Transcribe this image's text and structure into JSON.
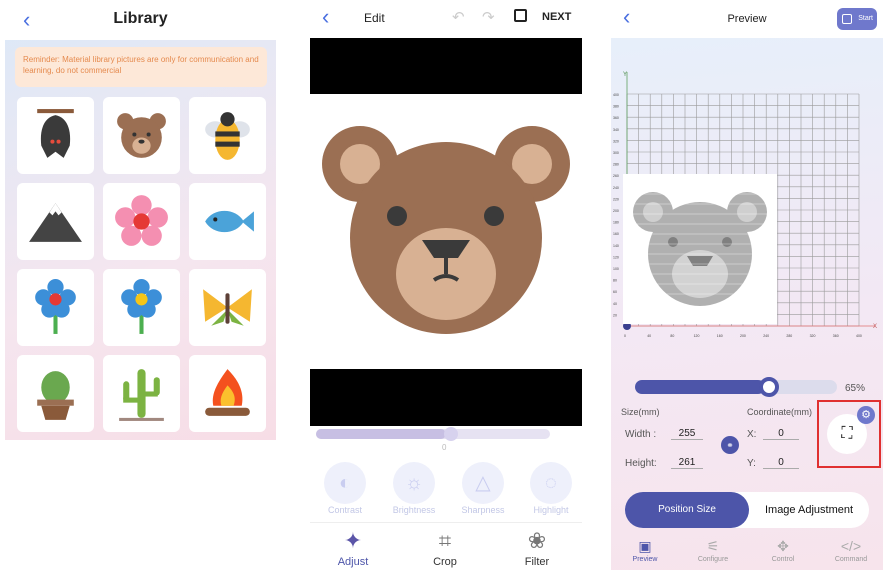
{
  "library": {
    "title": "Library",
    "reminder": "Reminder: Material library pictures are only for communication and learning, do not commercial",
    "items": [
      "bat-icon",
      "bear-icon",
      "bee-icon",
      "mountain-icon",
      "flower-pink-icon",
      "fish-icon",
      "flower-blue-red-icon",
      "flower-blue-yellow-icon",
      "butterfly-icon",
      "cactus-pot-icon",
      "cactus-icon",
      "campfire-icon"
    ]
  },
  "edit": {
    "title": "Edit",
    "next": "NEXT",
    "slider_value": "0",
    "tools": [
      "Contrast",
      "Brightness",
      "Sharpness",
      "Highlight"
    ],
    "tabs": [
      "Adjust",
      "Crop",
      "Filter"
    ]
  },
  "preview": {
    "title": "Preview",
    "start_label": "Start",
    "scale_percent": "65%",
    "size_label": "Size(mm)",
    "coord_label": "Coordinate(mm)",
    "width_label": "Width :",
    "width_value": "255",
    "height_label": "Height:",
    "height_value": "261",
    "x_label": "X:",
    "x_value": "0",
    "y_label": "Y:",
    "y_value": "0",
    "y_axis": "Y",
    "x_axis": "X",
    "y_ticks": [
      "400",
      "380",
      "360",
      "340",
      "320",
      "300",
      "280",
      "260",
      "240",
      "220",
      "200",
      "180",
      "160",
      "140",
      "120",
      "100",
      "80",
      "60",
      "40",
      "20"
    ],
    "x_ticks": [
      "0",
      "40",
      "80",
      "120",
      "160",
      "200",
      "240",
      "280",
      "320",
      "360",
      "400"
    ],
    "segment_position": "Position Size",
    "segment_image": "Image Adjustment",
    "tabs": [
      "Preview",
      "Configure",
      "Control",
      "Command"
    ]
  },
  "colors": {
    "accent": "#4d55a9",
    "warn": "#e58a4e",
    "highlight": "#e03030",
    "bear": "#9b6f53",
    "bear_light": "#d8b193"
  }
}
